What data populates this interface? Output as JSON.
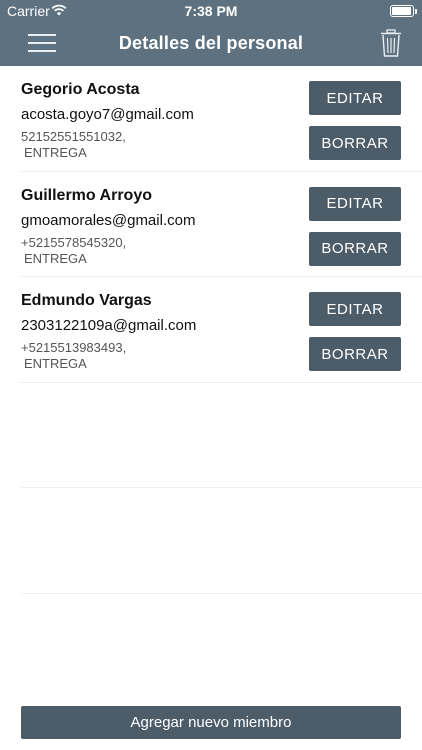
{
  "status_bar": {
    "carrier": "Carrier",
    "time": "7:38 PM"
  },
  "nav": {
    "title": "Detalles del personal",
    "menu_icon": "hamburger-menu-icon",
    "trash_icon": "trash-icon"
  },
  "staff": [
    {
      "name": "Gegorio Acosta",
      "email": "acosta.goyo7@gmail.com",
      "phone": "52152551551032,",
      "role": "ENTREGA",
      "edit_label": "EDITAR",
      "delete_label": "BORRAR"
    },
    {
      "name": "Guillermo Arroyo",
      "email": "gmoamorales@gmail.com",
      "phone": "+5215578545320,",
      "role": "ENTREGA",
      "edit_label": "EDITAR",
      "delete_label": "BORRAR"
    },
    {
      "name": "Edmundo Vargas",
      "email": "2303122109a@gmail.com",
      "phone": "+5215513983493,",
      "role": "ENTREGA",
      "edit_label": "EDITAR",
      "delete_label": "BORRAR"
    }
  ],
  "footer": {
    "add_label": "Agregar nuevo miembro"
  },
  "colors": {
    "header": "#5d7180",
    "button": "#4c5c68"
  }
}
